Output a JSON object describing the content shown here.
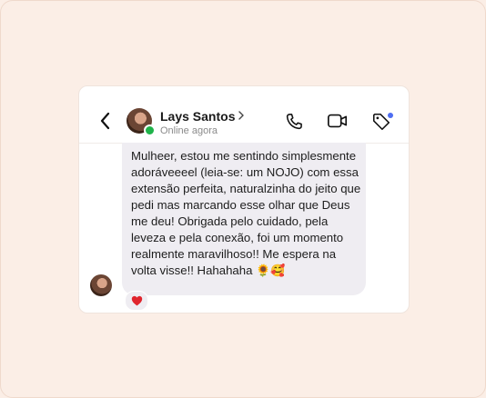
{
  "header": {
    "contact_name": "Lays Santos",
    "status": "Online agora"
  },
  "message": {
    "text_before_emoji": "Mulheer, estou me sentindo simplesmente adoráveeeel (leia-se: um NOJO) com essa extensão perfeita, naturalzinha do jeito que pedi mas marcando esse olhar que Deus me deu! Obrigada pelo cuidado, pela leveza e pela conexão, foi um momento realmente maravilhoso!! Me espera na volta visse!! Hahahaha",
    "emojis": "🌻🥰",
    "reaction": "♥"
  },
  "colors": {
    "online": "#1fb34a",
    "notification": "#4f6ef2",
    "reaction": "#e0252d",
    "bubble": "#efedf2"
  },
  "icons": [
    "back-chevron-icon",
    "phone-icon",
    "video-camera-icon",
    "tag-icon"
  ]
}
